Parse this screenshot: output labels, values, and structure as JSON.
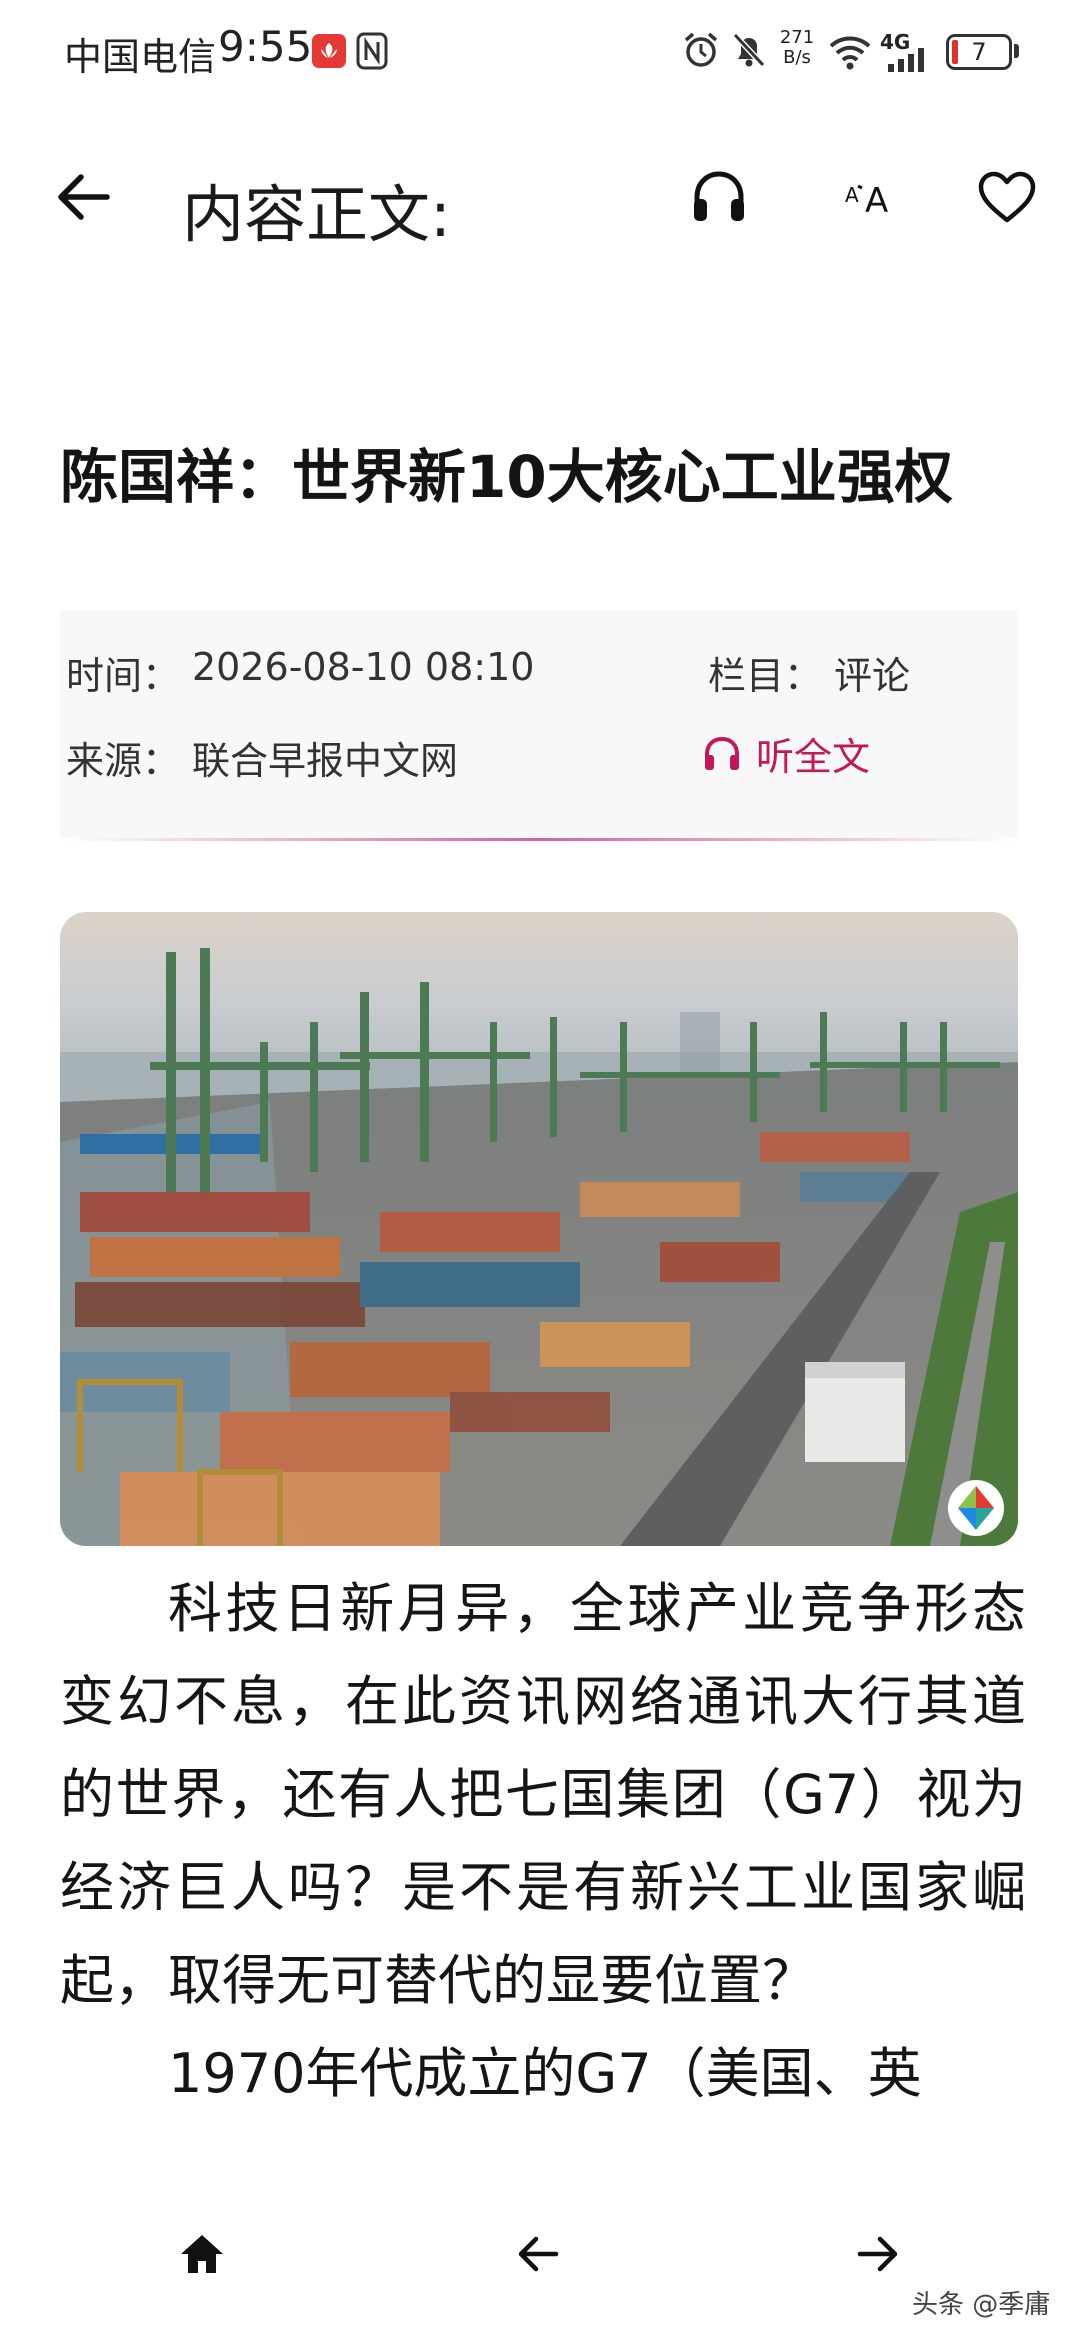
{
  "status_bar": {
    "carrier": "中国电信",
    "time": "9:55",
    "net_speed_value": "271",
    "net_speed_unit": "B/s",
    "network_type": "4G",
    "battery_level": "7",
    "icons": [
      "huawei-app-icon",
      "nfc-icon",
      "alarm-icon",
      "bell-muted-icon",
      "wifi-icon",
      "signal-icon",
      "battery-icon"
    ]
  },
  "header": {
    "title": "内容正文:",
    "icons": {
      "back": "arrow-left-icon",
      "listen": "headphones-icon",
      "font_size": "font-size-icon",
      "favorite": "heart-icon"
    }
  },
  "article": {
    "title": "陈国祥：世界新10大核心工业强权",
    "meta": {
      "time_label": "时间：",
      "time_value": "2026-08-10 08:10",
      "column_label": "栏目：",
      "column_value": "评论",
      "source_label": "来源：",
      "source_value": "联合早报中文网",
      "listen_full_label": "听全文"
    },
    "image_description": "container-port-aerial-photo",
    "paragraphs": [
      "科技日新月异，全球产业竞争形态变幻不息，在此资讯网络通讯大行其道的世界，还有人把七国集团（G7）视为经济巨人吗？是不是有新兴工业国家崛起，取得无可替代的显要位置？",
      "1970年代成立的G7（美国、英"
    ]
  },
  "bottom_nav": {
    "icons": {
      "home": "home-icon",
      "prev": "arrow-left-icon",
      "next": "arrow-right-icon"
    }
  },
  "watermark": "头条 @季庸",
  "colors": {
    "accent": "#c2185b",
    "meta_background": "#f8f8f9",
    "text": "#151515",
    "battery_low": "#e5302a"
  }
}
